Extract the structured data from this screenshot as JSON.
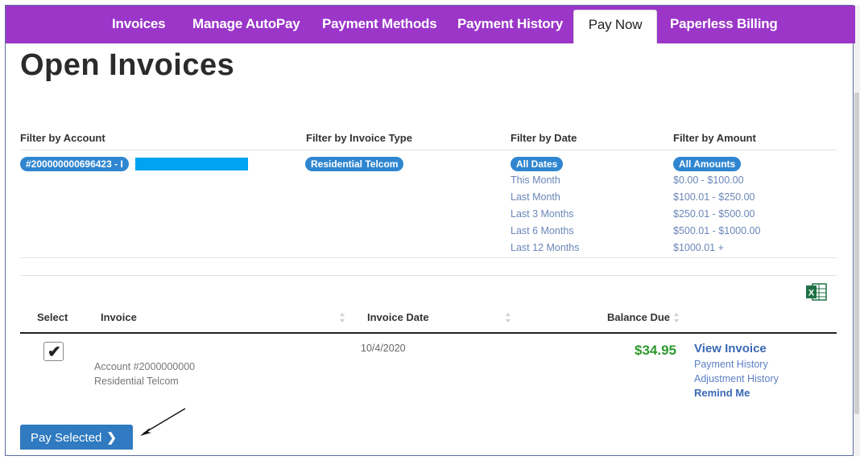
{
  "nav": {
    "tabs": [
      {
        "label": "Invoices"
      },
      {
        "label": "Manage AutoPay"
      },
      {
        "label": "Payment Methods"
      },
      {
        "label": "Payment History"
      },
      {
        "label": "Pay Now",
        "active": true
      },
      {
        "label": "Paperless Billing"
      }
    ],
    "bg_color": "#9b36c9"
  },
  "page_title": "Open Invoices",
  "filters": {
    "account": {
      "heading": "Filter by Account",
      "selected": "#200000000696423 - I"
    },
    "invoice_type": {
      "heading": "Filter by Invoice Type",
      "selected": "Residential Telcom"
    },
    "date": {
      "heading": "Filter by Date",
      "selected": "All Dates",
      "options": [
        "This Month",
        "Last Month",
        "Last 3 Months",
        "Last 6 Months",
        "Last 12 Months"
      ]
    },
    "amount": {
      "heading": "Filter by Amount",
      "selected": "All Amounts",
      "options": [
        "$0.00 - $100.00",
        "$100.01 - $250.00",
        "$250.01 - $500.00",
        "$500.01 - $1000.00",
        "$1000.01 +"
      ]
    },
    "pill_color": "#2f86d0"
  },
  "table": {
    "headers": {
      "select": "Select",
      "invoice": "Invoice",
      "invoice_date": "Invoice Date",
      "balance_due": "Balance Due"
    },
    "rows": [
      {
        "checked": true,
        "account": "Account #2000000000",
        "type": "Residential Telcom",
        "date": "10/4/2020",
        "balance": "$34.95",
        "actions": {
          "view": "View Invoice",
          "payment_history": "Payment History",
          "adjustment_history": "Adjustment History",
          "remind": "Remind Me"
        }
      }
    ]
  },
  "pay_button": {
    "label": "Pay Selected",
    "chevron": "❯"
  },
  "icons": {
    "export": "excel-icon",
    "sort": "sort-icon",
    "check": "✔"
  }
}
